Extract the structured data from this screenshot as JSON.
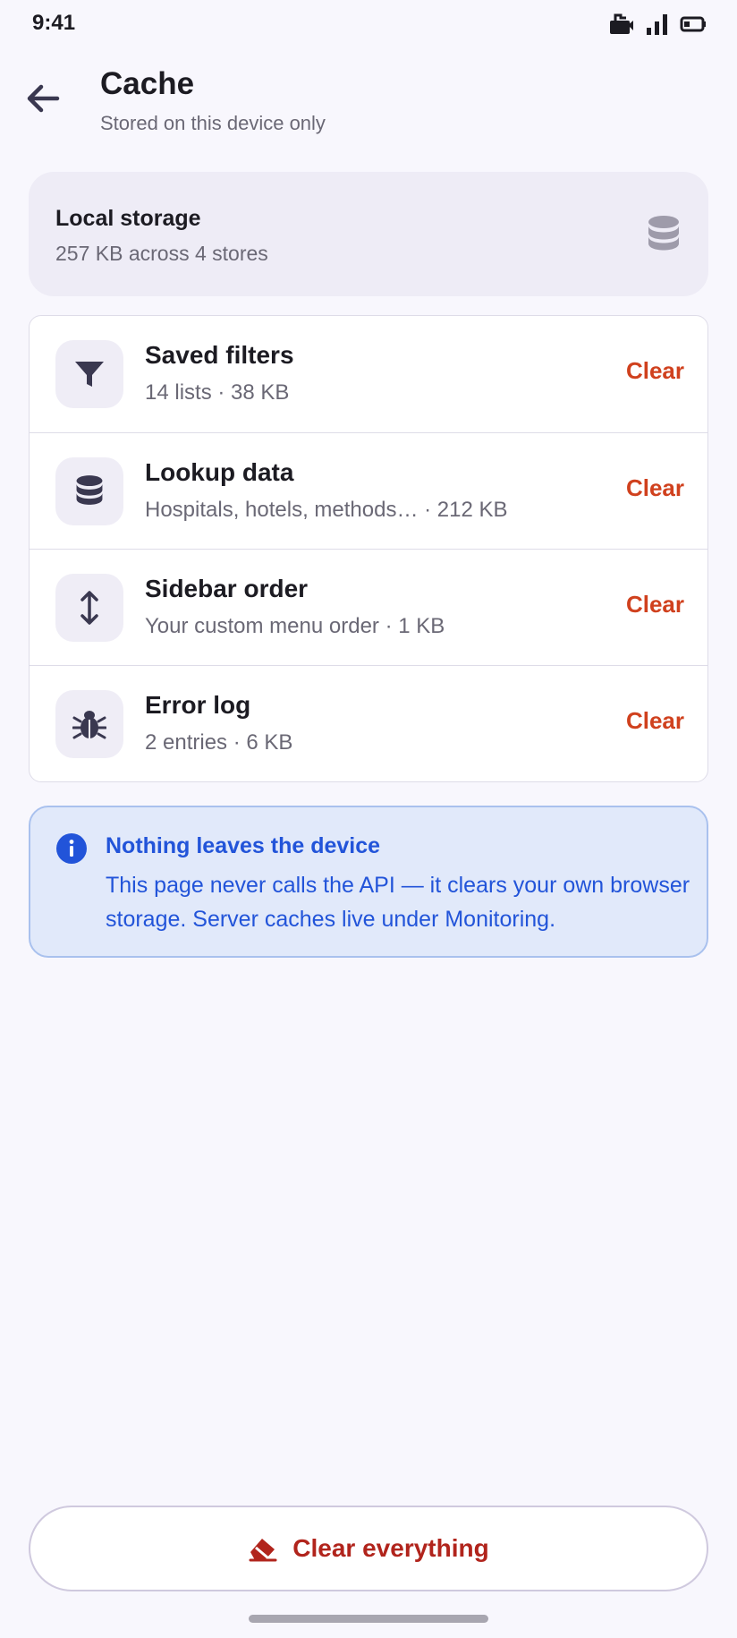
{
  "status_bar": {
    "time": "9:41",
    "icons": [
      "notification-icon",
      "signal-icon",
      "battery-icon"
    ]
  },
  "header": {
    "back_icon": "arrow-left-icon",
    "title": "Cache",
    "subtitle": "Stored on this device only"
  },
  "summary": {
    "title": "Local storage",
    "subtitle": "257 KB across 4 stores",
    "icon": "database-icon"
  },
  "stores": [
    {
      "title": "Saved filters",
      "subtitle": "14 lists · 38 KB",
      "icon": "filter-icon",
      "action": "Clear"
    },
    {
      "title": "Lookup data",
      "subtitle": "Hospitals, hotels, methods… · 212 KB",
      "icon": "database-icon",
      "action": "Clear"
    },
    {
      "title": "Sidebar order",
      "subtitle": "Your custom menu order · 1 KB",
      "icon": "vertical-arrows-icon",
      "action": "Clear"
    },
    {
      "title": "Error log",
      "subtitle": "2 entries · 6 KB",
      "icon": "bug-icon",
      "action": "Clear"
    }
  ],
  "info": {
    "icon": "info-icon",
    "title": "Nothing leaves the device",
    "text": "This page never calls the API — it clears your own browser storage. Server caches live under Monitoring."
  },
  "footer": {
    "clear_all_label": "Clear everything",
    "clear_all_icon": "eraser-icon"
  },
  "colors": {
    "background": "#f8f7fd",
    "accent_danger": "#d0411e",
    "clear_all_text": "#b1241c",
    "info_blue": "#2254d9",
    "info_bg": "#e1e9fa"
  }
}
